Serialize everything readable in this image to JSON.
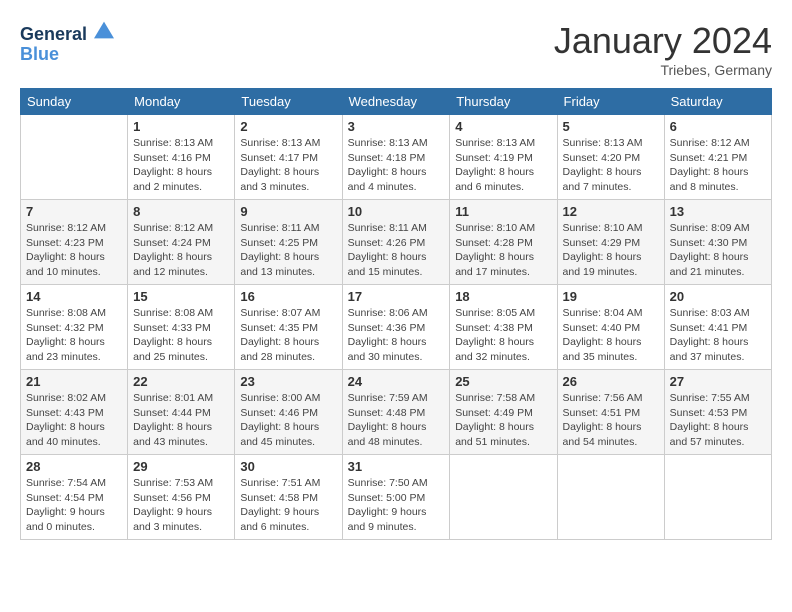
{
  "header": {
    "logo_line1": "General",
    "logo_line2": "Blue",
    "month": "January 2024",
    "location": "Triebes, Germany"
  },
  "weekdays": [
    "Sunday",
    "Monday",
    "Tuesday",
    "Wednesday",
    "Thursday",
    "Friday",
    "Saturday"
  ],
  "weeks": [
    [
      {
        "day": "",
        "info": ""
      },
      {
        "day": "1",
        "info": "Sunrise: 8:13 AM\nSunset: 4:16 PM\nDaylight: 8 hours\nand 2 minutes."
      },
      {
        "day": "2",
        "info": "Sunrise: 8:13 AM\nSunset: 4:17 PM\nDaylight: 8 hours\nand 3 minutes."
      },
      {
        "day": "3",
        "info": "Sunrise: 8:13 AM\nSunset: 4:18 PM\nDaylight: 8 hours\nand 4 minutes."
      },
      {
        "day": "4",
        "info": "Sunrise: 8:13 AM\nSunset: 4:19 PM\nDaylight: 8 hours\nand 6 minutes."
      },
      {
        "day": "5",
        "info": "Sunrise: 8:13 AM\nSunset: 4:20 PM\nDaylight: 8 hours\nand 7 minutes."
      },
      {
        "day": "6",
        "info": "Sunrise: 8:12 AM\nSunset: 4:21 PM\nDaylight: 8 hours\nand 8 minutes."
      }
    ],
    [
      {
        "day": "7",
        "info": "Sunrise: 8:12 AM\nSunset: 4:23 PM\nDaylight: 8 hours\nand 10 minutes."
      },
      {
        "day": "8",
        "info": "Sunrise: 8:12 AM\nSunset: 4:24 PM\nDaylight: 8 hours\nand 12 minutes."
      },
      {
        "day": "9",
        "info": "Sunrise: 8:11 AM\nSunset: 4:25 PM\nDaylight: 8 hours\nand 13 minutes."
      },
      {
        "day": "10",
        "info": "Sunrise: 8:11 AM\nSunset: 4:26 PM\nDaylight: 8 hours\nand 15 minutes."
      },
      {
        "day": "11",
        "info": "Sunrise: 8:10 AM\nSunset: 4:28 PM\nDaylight: 8 hours\nand 17 minutes."
      },
      {
        "day": "12",
        "info": "Sunrise: 8:10 AM\nSunset: 4:29 PM\nDaylight: 8 hours\nand 19 minutes."
      },
      {
        "day": "13",
        "info": "Sunrise: 8:09 AM\nSunset: 4:30 PM\nDaylight: 8 hours\nand 21 minutes."
      }
    ],
    [
      {
        "day": "14",
        "info": "Sunrise: 8:08 AM\nSunset: 4:32 PM\nDaylight: 8 hours\nand 23 minutes."
      },
      {
        "day": "15",
        "info": "Sunrise: 8:08 AM\nSunset: 4:33 PM\nDaylight: 8 hours\nand 25 minutes."
      },
      {
        "day": "16",
        "info": "Sunrise: 8:07 AM\nSunset: 4:35 PM\nDaylight: 8 hours\nand 28 minutes."
      },
      {
        "day": "17",
        "info": "Sunrise: 8:06 AM\nSunset: 4:36 PM\nDaylight: 8 hours\nand 30 minutes."
      },
      {
        "day": "18",
        "info": "Sunrise: 8:05 AM\nSunset: 4:38 PM\nDaylight: 8 hours\nand 32 minutes."
      },
      {
        "day": "19",
        "info": "Sunrise: 8:04 AM\nSunset: 4:40 PM\nDaylight: 8 hours\nand 35 minutes."
      },
      {
        "day": "20",
        "info": "Sunrise: 8:03 AM\nSunset: 4:41 PM\nDaylight: 8 hours\nand 37 minutes."
      }
    ],
    [
      {
        "day": "21",
        "info": "Sunrise: 8:02 AM\nSunset: 4:43 PM\nDaylight: 8 hours\nand 40 minutes."
      },
      {
        "day": "22",
        "info": "Sunrise: 8:01 AM\nSunset: 4:44 PM\nDaylight: 8 hours\nand 43 minutes."
      },
      {
        "day": "23",
        "info": "Sunrise: 8:00 AM\nSunset: 4:46 PM\nDaylight: 8 hours\nand 45 minutes."
      },
      {
        "day": "24",
        "info": "Sunrise: 7:59 AM\nSunset: 4:48 PM\nDaylight: 8 hours\nand 48 minutes."
      },
      {
        "day": "25",
        "info": "Sunrise: 7:58 AM\nSunset: 4:49 PM\nDaylight: 8 hours\nand 51 minutes."
      },
      {
        "day": "26",
        "info": "Sunrise: 7:56 AM\nSunset: 4:51 PM\nDaylight: 8 hours\nand 54 minutes."
      },
      {
        "day": "27",
        "info": "Sunrise: 7:55 AM\nSunset: 4:53 PM\nDaylight: 8 hours\nand 57 minutes."
      }
    ],
    [
      {
        "day": "28",
        "info": "Sunrise: 7:54 AM\nSunset: 4:54 PM\nDaylight: 9 hours\nand 0 minutes."
      },
      {
        "day": "29",
        "info": "Sunrise: 7:53 AM\nSunset: 4:56 PM\nDaylight: 9 hours\nand 3 minutes."
      },
      {
        "day": "30",
        "info": "Sunrise: 7:51 AM\nSunset: 4:58 PM\nDaylight: 9 hours\nand 6 minutes."
      },
      {
        "day": "31",
        "info": "Sunrise: 7:50 AM\nSunset: 5:00 PM\nDaylight: 9 hours\nand 9 minutes."
      },
      {
        "day": "",
        "info": ""
      },
      {
        "day": "",
        "info": ""
      },
      {
        "day": "",
        "info": ""
      }
    ]
  ]
}
